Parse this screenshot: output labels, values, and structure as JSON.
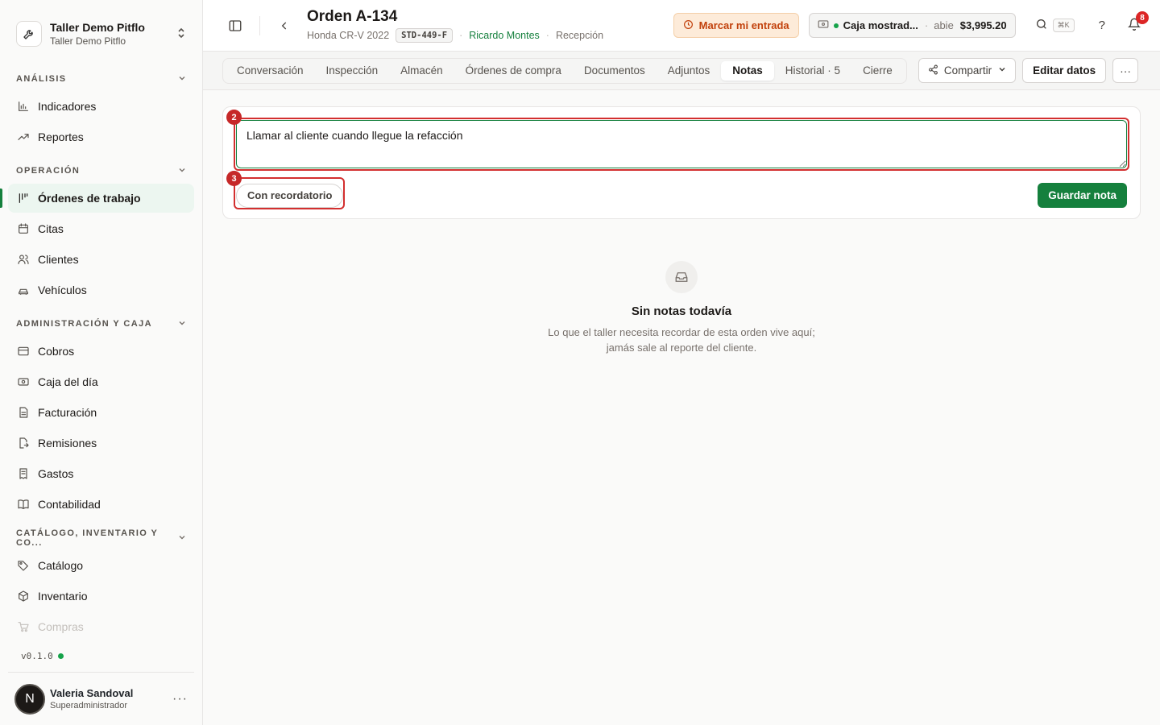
{
  "org": {
    "name": "Taller Demo Pitflo",
    "subtitle": "Taller Demo Pitflo"
  },
  "sidebar": {
    "sections": [
      {
        "title": "ANÁLISIS",
        "items": [
          {
            "label": "Indicadores",
            "icon": "chart-bars-icon"
          },
          {
            "label": "Reportes",
            "icon": "trend-up-icon"
          }
        ]
      },
      {
        "title": "OPERACIÓN",
        "items": [
          {
            "label": "Órdenes de trabajo",
            "icon": "kanban-icon",
            "active": true
          },
          {
            "label": "Citas",
            "icon": "calendar-icon"
          },
          {
            "label": "Clientes",
            "icon": "users-icon"
          },
          {
            "label": "Vehículos",
            "icon": "car-icon"
          }
        ]
      },
      {
        "title": "ADMINISTRACIÓN Y CAJA",
        "items": [
          {
            "label": "Cobros",
            "icon": "credit-card-icon"
          },
          {
            "label": "Caja del día",
            "icon": "cash-icon"
          },
          {
            "label": "Facturación",
            "icon": "invoice-icon"
          },
          {
            "label": "Remisiones",
            "icon": "export-doc-icon"
          },
          {
            "label": "Gastos",
            "icon": "receipt-icon"
          },
          {
            "label": "Contabilidad",
            "icon": "book-icon"
          }
        ]
      },
      {
        "title": "CATÁLOGO, INVENTARIO Y CO...",
        "items": [
          {
            "label": "Catálogo",
            "icon": "tags-icon"
          },
          {
            "label": "Inventario",
            "icon": "box-icon"
          },
          {
            "label": "Compras",
            "icon": "cart-icon"
          }
        ]
      }
    ],
    "version": "v0.1.0",
    "user": {
      "initial": "N",
      "name": "Valeria Sandoval",
      "role": "Superadministrador"
    }
  },
  "header": {
    "title": "Orden A-134",
    "vehicle": "Honda CR-V 2022",
    "plate": "STD-449-F",
    "client": "Ricardo Montes",
    "stage": "Recepción",
    "clock_in_label": "Marcar mi entrada",
    "cash": {
      "name": "Caja mostrad...",
      "status": "abie",
      "amount": "$3,995.20"
    },
    "search_shortcut": "⌘K",
    "notifications_count": "8"
  },
  "tabs": [
    {
      "label": "Conversación"
    },
    {
      "label": "Inspección"
    },
    {
      "label": "Almacén"
    },
    {
      "label": "Órdenes de compra"
    },
    {
      "label": "Documentos"
    },
    {
      "label": "Adjuntos"
    },
    {
      "label": "Notas",
      "active": true
    },
    {
      "label": "Historial · 5"
    },
    {
      "label": "Cierre"
    }
  ],
  "actions": {
    "share_label": "Compartir",
    "edit_label": "Editar datos"
  },
  "note": {
    "value": "Llamar al cliente cuando llegue la refacción",
    "reminder_label": "Con recordatorio",
    "save_label": "Guardar nota",
    "annotation_input": "2",
    "annotation_reminder": "3"
  },
  "empty": {
    "title": "Sin notas todavía",
    "line1": "Lo que el taller necesita recordar de esta orden vive aquí;",
    "line2": "jamás sale al reporte del cliente."
  },
  "colors": {
    "accent": "#15803d",
    "highlight": "#d32f2f",
    "warning": "#c2410c"
  }
}
